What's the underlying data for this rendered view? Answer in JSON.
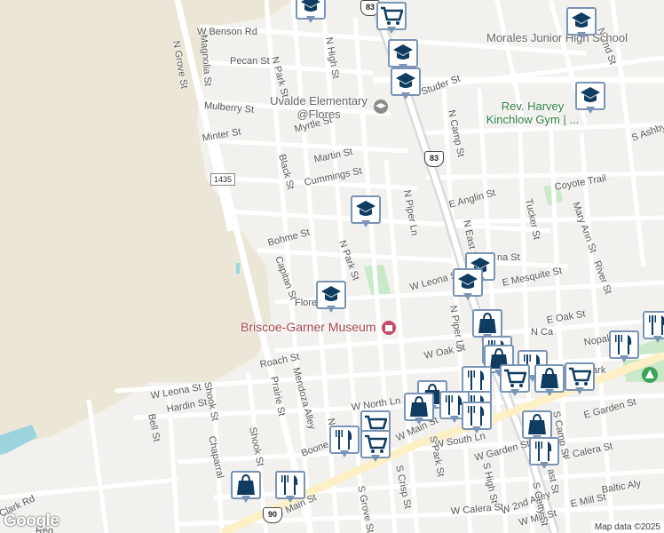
{
  "map": {
    "attribution": "Map data ©2025",
    "logo": "Google"
  },
  "highway_shields": [
    {
      "id": "us83-top",
      "text": "83"
    },
    {
      "id": "us83-mid",
      "text": "83"
    },
    {
      "id": "us90",
      "text": "90"
    },
    {
      "id": "fm1435",
      "text": "1435"
    }
  ],
  "street_labels": [
    "W Benson Rd",
    "N Grove St",
    "Magnolia St",
    "Pecan St",
    "N Park St",
    "N High St",
    "Mulberry St",
    "Minter St",
    "Myrtle St",
    "Black St",
    "Martin St",
    "Cummings St",
    "Studer St",
    "N Camp St",
    "S Ashby",
    "Coyote Trail",
    "E Anglin St",
    "N Piper Ln",
    "N East St",
    "Tucker St",
    "Mary Ann St",
    "River St",
    "Bohme St",
    "Capitan St",
    "N Park St",
    "W Leona St",
    "E Mesquite St",
    "na St",
    "Flore",
    "N Piper Ln",
    "N Ca",
    "E Oak St",
    "Nopal St",
    "W Oak St",
    "Roach St",
    "W Leona St",
    "Shook St",
    "Hardin St",
    "Bell St",
    "Prairie St",
    "Mendoza Alley",
    "N Grove",
    "W North Ln",
    "W Main St",
    "Chaparral",
    "Shook St",
    "Boone",
    "W Main St",
    "W South Ln",
    "S Crisp St",
    "S Park St",
    "S High St",
    "W Garden St",
    "E Garden St",
    "E Calera St",
    "Baltic Aly",
    "S Camp St",
    "S Grove St",
    "W Calera St",
    "W 2nd Alley",
    "E Mill St",
    "W Mill St",
    "S Getty St",
    "Clark Rd",
    "Reg",
    "N 2nd St",
    "ast St",
    "rial Park"
  ],
  "places": {
    "morales": "Morales Junior High School",
    "uvalde_elem": "Uvalde Elementary @Flores",
    "harvey": "Rev. Harvey Kinchlow Gym | ...",
    "briscoe": "Briscoe-Garner Museum"
  },
  "markers": [
    {
      "icon": "school-icon"
    },
    {
      "icon": "grocery-icon"
    },
    {
      "icon": "school-icon"
    },
    {
      "icon": "school-icon"
    },
    {
      "icon": "school-icon"
    },
    {
      "icon": "school-icon"
    },
    {
      "icon": "school-icon"
    },
    {
      "icon": "school-icon"
    },
    {
      "icon": "school-icon"
    },
    {
      "icon": "school-icon"
    },
    {
      "icon": "shopping-icon"
    },
    {
      "icon": "restaurant-icon"
    },
    {
      "icon": "restaurant-icon"
    },
    {
      "icon": "restaurant-icon"
    },
    {
      "icon": "grocery-icon"
    },
    {
      "icon": "shopping-icon"
    },
    {
      "icon": "restaurant-icon"
    },
    {
      "icon": "shopping-icon"
    },
    {
      "icon": "grocery-icon"
    },
    {
      "icon": "restaurant-icon"
    },
    {
      "icon": "shopping-icon"
    },
    {
      "icon": "restaurant-icon"
    },
    {
      "icon": "restaurant-icon"
    },
    {
      "icon": "shopping-icon"
    },
    {
      "icon": "restaurant-icon"
    },
    {
      "icon": "grocery-icon"
    },
    {
      "icon": "restaurant-icon"
    },
    {
      "icon": "shopping-icon"
    },
    {
      "icon": "restaurant-icon"
    },
    {
      "icon": "grocery-icon"
    },
    {
      "icon": "restaurant-icon"
    },
    {
      "icon": "shopping-icon"
    }
  ]
}
